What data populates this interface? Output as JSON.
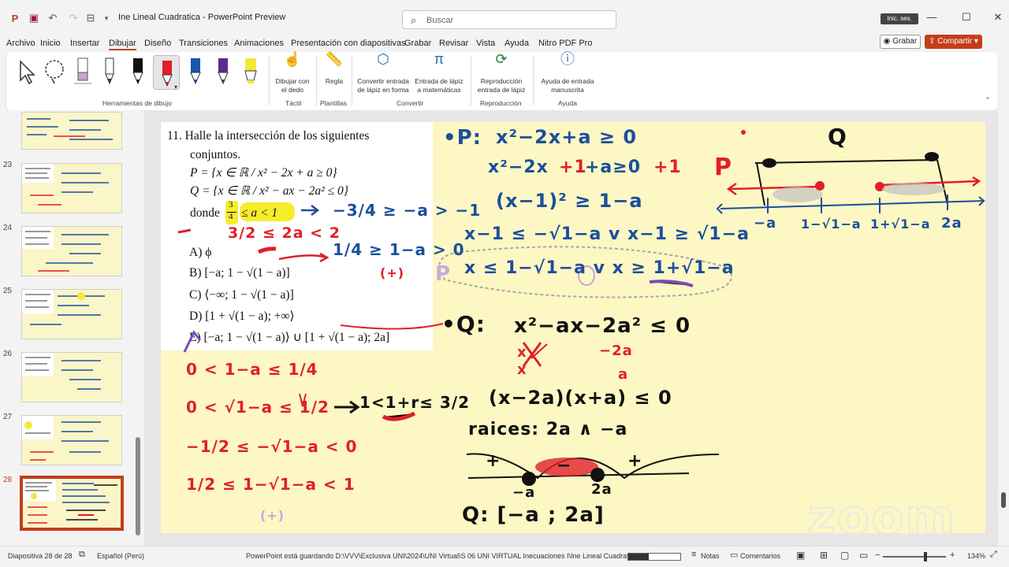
{
  "window": {
    "title": "Ine Lineal Cuadratica  -  PowerPoint Preview",
    "signin": "Inic. ses.",
    "search_placeholder": "Buscar"
  },
  "menu": [
    "Archivo",
    "Inicio",
    "Insertar",
    "Dibujar",
    "Diseño",
    "Transiciones",
    "Animaciones",
    "Presentación con diapositivas",
    "Grabar",
    "Revisar",
    "Vista",
    "Ayuda",
    "Nitro PDF Pro"
  ],
  "menu_active": "Dibujar",
  "buttons": {
    "grabar": "Grabar",
    "compartir": "Compartir"
  },
  "ribbon": {
    "groups": {
      "tools": "Herramientas de dibujo",
      "tactil": "Táctil",
      "plantillas": "Plantillas",
      "convertir": "Convertir",
      "reproduccion": "Reproducción",
      "ayuda": "Ayuda"
    },
    "btn_finger": [
      "Dibujar con",
      "el dedo"
    ],
    "btn_regla": "Regla",
    "btn_convert_shape": [
      "Convertir entrada",
      "de lápiz en forma"
    ],
    "btn_convert_math": [
      "Entrada de lápiz",
      "a matemáticas"
    ],
    "btn_replay": [
      "Reproducción",
      "entrada de lápiz"
    ],
    "btn_help": [
      "Ayuda de entrada",
      "manuscrita"
    ],
    "pen_colors": [
      "#111111",
      "#e01f2a",
      "#1a56b0",
      "#5a2d91",
      "#f5e83a"
    ]
  },
  "thumbnails": [
    {
      "num": "23"
    },
    {
      "num": "24"
    },
    {
      "num": "25"
    },
    {
      "num": "26"
    },
    {
      "num": "27"
    },
    {
      "num": "28",
      "selected": true
    }
  ],
  "slide": {
    "question": {
      "header": "11. Halle la intersección de los siguientes",
      "header2": "conjuntos.",
      "P": "P = {x ∈ ℝ / x² − 2x + a ≥ 0}",
      "Q": "Q = {x ∈ ℝ / x² − ax − 2a² ≤ 0}",
      "donde": "donde",
      "condition": "≤ a < 1",
      "frac_num": "3",
      "frac_den": "4",
      "options": [
        "A) ϕ",
        "B) [−a; 1 − √(1 − a)]",
        "C) ⟨−∞; 1 − √(1 − a)]",
        "D) [1 + √(1 − a); +∞⟩",
        "E) [−a; 1 − √(1 − a)⟩ ∪ [1 + √(1 − a); 2a]"
      ]
    },
    "handwriting": {
      "p_label": "•P:",
      "p1": "x²−2x+a ≥ 0",
      "p2a": "x²−2x",
      "p2b": "+1",
      "p2c": "+a≥0",
      "p2d": "+1",
      "p3": "(x−1)² ≥ 1−a",
      "p4": "x−1 ≤ −√1−a  v  x−1 ≥ √1−a",
      "p5": "x ≤ 1−√1−a  v  x ≥ 1+√1−a",
      "q_label": "•Q:",
      "q1": "x²−ax−2a² ≤ 0",
      "q_x1": "x",
      "q_x2": "x",
      "q_f1": "−2a",
      "q_f2": "a",
      "q2": "(x−2a)(x+a) ≤ 0",
      "q3": "raices: 2a ∧ −a",
      "q_minus_a": "−a",
      "q_2a": "2a",
      "q_plus1": "+",
      "q_minus": "−",
      "q_plus2": "+",
      "q_result": "Q: [−a ; 2a]",
      "cond1": "−3/4 ≥ −a > −1",
      "cond2": "3/2 ≤ 2a < 2",
      "cond3": "1/4 ≥ 1−a > 0",
      "cond3_tag": "(+)",
      "s1": "0 < 1−a ≤ 1/4",
      "s2": "0 < √1−a ≤ 1/2",
      "s2_result": "1<1+r≤ 3/2",
      "s3": "−1/2 ≤ −√1−a < 0",
      "s4": "1/2 ≤ 1−√1−a < 1",
      "s4_tag": "(+)",
      "numline_labels": [
        "−a",
        "1−√1−a",
        "1+√1−a",
        "2a"
      ],
      "numline_P": "P",
      "numline_Q": "Q",
      "p_margin": "P"
    }
  },
  "status": {
    "slide_info": "Diapositiva 28 de 28",
    "language": "Español (Perú)",
    "saving": "PowerPoint está guardando D:\\VVV\\Exclusiva UNI\\2024\\UNI Virtual\\S 06 UNI VIRTUAL Inecuaciones I\\Ine Lineal Cuadratica.pptx.",
    "progress": 0.4,
    "notas": "Notas",
    "comentarios": "Comentarios",
    "zoom": "134%"
  },
  "watermark": "zoom"
}
